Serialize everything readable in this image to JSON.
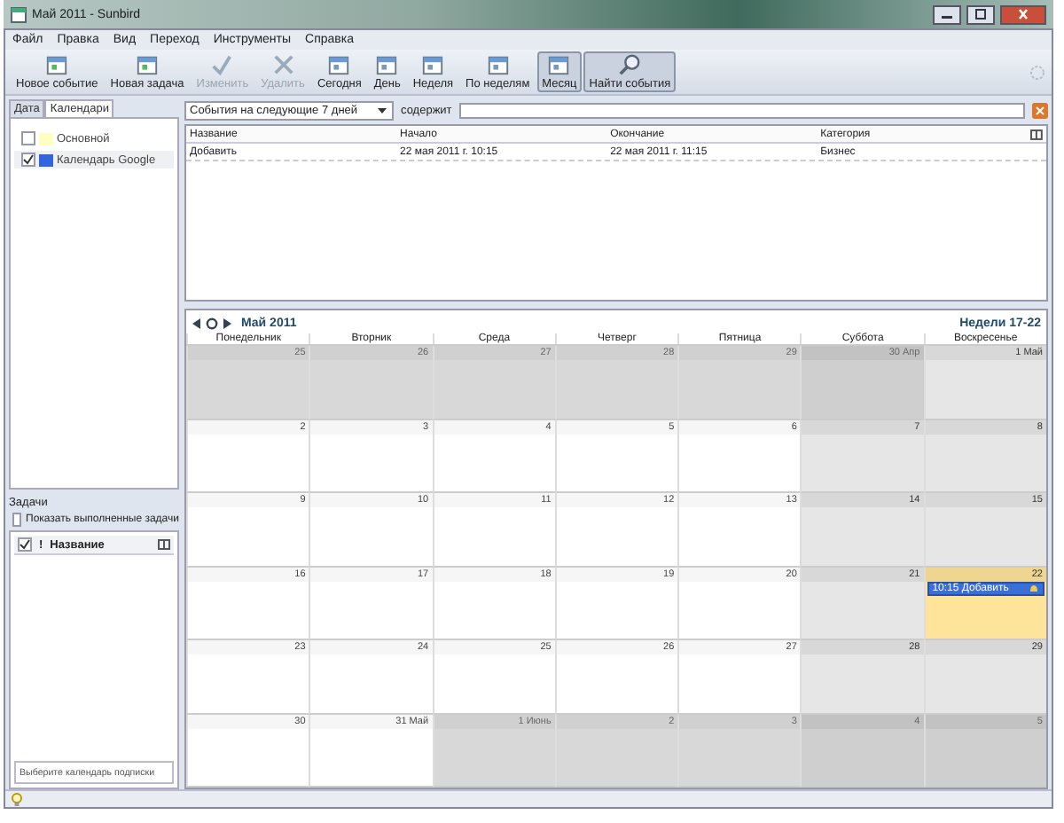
{
  "window": {
    "title": "Май 2011 - Sunbird"
  },
  "menu": [
    "Файл",
    "Правка",
    "Вид",
    "Переход",
    "Инструменты",
    "Справка"
  ],
  "toolbar": [
    {
      "label": "Новое событие",
      "disabled": false,
      "selected": false
    },
    {
      "label": "Новая задача",
      "disabled": false,
      "selected": false
    },
    {
      "label": "Изменить",
      "disabled": true,
      "selected": false
    },
    {
      "label": "Удалить",
      "disabled": true,
      "selected": false
    },
    {
      "label": "Сегодня",
      "disabled": false,
      "selected": false
    },
    {
      "label": "День",
      "disabled": false,
      "selected": false
    },
    {
      "label": "Неделя",
      "disabled": false,
      "selected": false
    },
    {
      "label": "По неделям",
      "disabled": false,
      "selected": false
    },
    {
      "label": "Месяц",
      "disabled": false,
      "selected": true
    },
    {
      "label": "Найти события",
      "disabled": false,
      "selected": true
    }
  ],
  "sidebar": {
    "tabs": [
      {
        "label": "Дата",
        "selected": false
      },
      {
        "label": "Календари",
        "selected": true
      }
    ],
    "calendars": [
      {
        "name": "Основной",
        "checked": false,
        "color": "#ffffc0"
      },
      {
        "name": "Календарь Google",
        "checked": true,
        "color": "#3366dd"
      }
    ],
    "tasks": {
      "title": "Задачи",
      "show_completed": {
        "label": "Показать выполненные задачи",
        "checked": false
      },
      "columns": [
        "!",
        "Название"
      ],
      "all_checked": true,
      "placeholder": "Выберите календарь подписки"
    }
  },
  "filter": {
    "range": "События на следующие 7 дней",
    "label": "содержит"
  },
  "events_table": {
    "columns": [
      "Название",
      "Начало",
      "Окончание",
      "Категория"
    ],
    "rows": [
      [
        "Добавить",
        "22 мая 2011 г. 10:15",
        "22 мая 2011 г. 11:15",
        "Бизнес"
      ]
    ]
  },
  "calendar": {
    "title": "Май 2011",
    "weeks_label": "Недели 17-22",
    "weekdays": [
      "Понедельник",
      "Вторник",
      "Среда",
      "Четверг",
      "Пятница",
      "Суббота",
      "Воскресенье"
    ],
    "weeks": [
      [
        {
          "day": "25",
          "other": true,
          "weekend": false,
          "today": false
        },
        {
          "day": "26",
          "other": true,
          "weekend": false,
          "today": false
        },
        {
          "day": "27",
          "other": true,
          "weekend": false,
          "today": false
        },
        {
          "day": "28",
          "other": true,
          "weekend": false,
          "today": false
        },
        {
          "day": "29",
          "other": true,
          "weekend": false,
          "today": false
        },
        {
          "day": "30 Апр",
          "other": true,
          "weekend": true,
          "today": false
        },
        {
          "day": "1 Май",
          "other": false,
          "weekend": true,
          "today": false
        }
      ],
      [
        {
          "day": "2",
          "other": false,
          "weekend": false,
          "today": false
        },
        {
          "day": "3",
          "other": false,
          "weekend": false,
          "today": false
        },
        {
          "day": "4",
          "other": false,
          "weekend": false,
          "today": false
        },
        {
          "day": "5",
          "other": false,
          "weekend": false,
          "today": false
        },
        {
          "day": "6",
          "other": false,
          "weekend": false,
          "today": false
        },
        {
          "day": "7",
          "other": false,
          "weekend": true,
          "today": false
        },
        {
          "day": "8",
          "other": false,
          "weekend": true,
          "today": false
        }
      ],
      [
        {
          "day": "9",
          "other": false,
          "weekend": false,
          "today": false
        },
        {
          "day": "10",
          "other": false,
          "weekend": false,
          "today": false
        },
        {
          "day": "11",
          "other": false,
          "weekend": false,
          "today": false
        },
        {
          "day": "12",
          "other": false,
          "weekend": false,
          "today": false
        },
        {
          "day": "13",
          "other": false,
          "weekend": false,
          "today": false
        },
        {
          "day": "14",
          "other": false,
          "weekend": true,
          "today": false
        },
        {
          "day": "15",
          "other": false,
          "weekend": true,
          "today": false
        }
      ],
      [
        {
          "day": "16",
          "other": false,
          "weekend": false,
          "today": false
        },
        {
          "day": "17",
          "other": false,
          "weekend": false,
          "today": false
        },
        {
          "day": "18",
          "other": false,
          "weekend": false,
          "today": false
        },
        {
          "day": "19",
          "other": false,
          "weekend": false,
          "today": false
        },
        {
          "day": "20",
          "other": false,
          "weekend": false,
          "today": false
        },
        {
          "day": "21",
          "other": false,
          "weekend": true,
          "today": false
        },
        {
          "day": "22",
          "other": false,
          "weekend": true,
          "today": true,
          "events": [
            "10:15 Добавить"
          ]
        }
      ],
      [
        {
          "day": "23",
          "other": false,
          "weekend": false,
          "today": false
        },
        {
          "day": "24",
          "other": false,
          "weekend": false,
          "today": false
        },
        {
          "day": "25",
          "other": false,
          "weekend": false,
          "today": false
        },
        {
          "day": "26",
          "other": false,
          "weekend": false,
          "today": false
        },
        {
          "day": "27",
          "other": false,
          "weekend": false,
          "today": false
        },
        {
          "day": "28",
          "other": false,
          "weekend": true,
          "today": false
        },
        {
          "day": "29",
          "other": false,
          "weekend": true,
          "today": false
        }
      ],
      [
        {
          "day": "30",
          "other": false,
          "weekend": false,
          "today": false
        },
        {
          "day": "31 Май",
          "other": false,
          "weekend": false,
          "today": false
        },
        {
          "day": "1 Июнь",
          "other": true,
          "weekend": false,
          "today": false
        },
        {
          "day": "2",
          "other": true,
          "weekend": false,
          "today": false
        },
        {
          "day": "3",
          "other": true,
          "weekend": false,
          "today": false
        },
        {
          "day": "4",
          "other": true,
          "weekend": true,
          "today": false
        },
        {
          "day": "5",
          "other": true,
          "weekend": true,
          "today": false
        }
      ]
    ]
  }
}
